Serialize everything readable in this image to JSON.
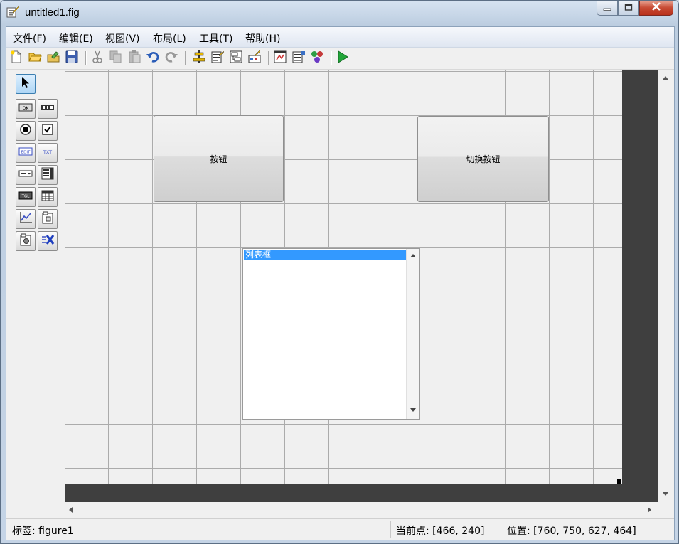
{
  "window": {
    "title": "untitled1.fig"
  },
  "menu": [
    {
      "id": "file",
      "label": "文件(F)"
    },
    {
      "id": "edit",
      "label": "编辑(E)"
    },
    {
      "id": "view",
      "label": "视图(V)"
    },
    {
      "id": "layout",
      "label": "布局(L)"
    },
    {
      "id": "tools",
      "label": "工具(T)"
    },
    {
      "id": "help",
      "label": "帮助(H)"
    }
  ],
  "toolbar": [
    {
      "id": "new",
      "icon": "new-file-icon"
    },
    {
      "id": "open",
      "icon": "open-folder-icon"
    },
    {
      "id": "open2",
      "icon": "open-folder-icon"
    },
    {
      "id": "save",
      "icon": "save-icon"
    },
    {
      "id": "cut",
      "icon": "cut-icon"
    },
    {
      "id": "copy",
      "icon": "copy-icon"
    },
    {
      "id": "paste",
      "icon": "paste-icon"
    },
    {
      "id": "undo",
      "icon": "undo-icon"
    },
    {
      "id": "redo",
      "icon": "redo-icon"
    },
    {
      "id": "align",
      "icon": "align-icon"
    },
    {
      "id": "menu-editor",
      "icon": "menu-editor-icon"
    },
    {
      "id": "tab-order",
      "icon": "tab-order-icon"
    },
    {
      "id": "toolbar-editor",
      "icon": "toolbar-editor-icon"
    },
    {
      "id": "mfile-editor",
      "icon": "editor-icon"
    },
    {
      "id": "property-inspector",
      "icon": "property-inspector-icon"
    },
    {
      "id": "object-browser",
      "icon": "object-browser-icon"
    },
    {
      "id": "run",
      "icon": "run-icon"
    }
  ],
  "palette": {
    "items": [
      {
        "id": "select",
        "icon": "pointer-icon",
        "text": ""
      },
      {
        "id": "pushbutton",
        "icon": "push-button-icon",
        "text": "OK"
      },
      {
        "id": "slider",
        "icon": "slider-icon",
        "text": ""
      },
      {
        "id": "radio",
        "icon": "radio-button-icon",
        "text": ""
      },
      {
        "id": "checkbox",
        "icon": "checkbox-icon",
        "text": ""
      },
      {
        "id": "edit",
        "icon": "edit-text-icon",
        "text": "EDIT"
      },
      {
        "id": "static",
        "icon": "static-text-icon",
        "text": "TXT"
      },
      {
        "id": "popup",
        "icon": "popup-menu-icon",
        "text": ""
      },
      {
        "id": "listbox",
        "icon": "listbox-icon",
        "text": ""
      },
      {
        "id": "toggle",
        "icon": "toggle-button-icon",
        "text": "TGL"
      },
      {
        "id": "table",
        "icon": "table-icon",
        "text": ""
      },
      {
        "id": "axes",
        "icon": "axes-icon",
        "text": ""
      },
      {
        "id": "panel",
        "icon": "panel-icon",
        "text": ""
      },
      {
        "id": "buttongroup",
        "icon": "button-group-icon",
        "text": ""
      },
      {
        "id": "activex",
        "icon": "activex-icon",
        "text": ""
      }
    ]
  },
  "canvas": {
    "buttons": [
      {
        "id": "pushbutton",
        "label": "按钮"
      },
      {
        "id": "togglebutton",
        "label": "切换按钮"
      }
    ],
    "listbox": {
      "items": [
        "列表框"
      ]
    }
  },
  "statusbar": {
    "tag": "标签: figure1",
    "current_point": "当前点:  [466, 240]",
    "position": "位置: [760, 750, 627, 464]"
  },
  "colors": {
    "selection": "#3399ff",
    "canvas_bg": "#f0f0f0",
    "outside_bg": "#3f3f3f",
    "grid": "#ababab"
  }
}
